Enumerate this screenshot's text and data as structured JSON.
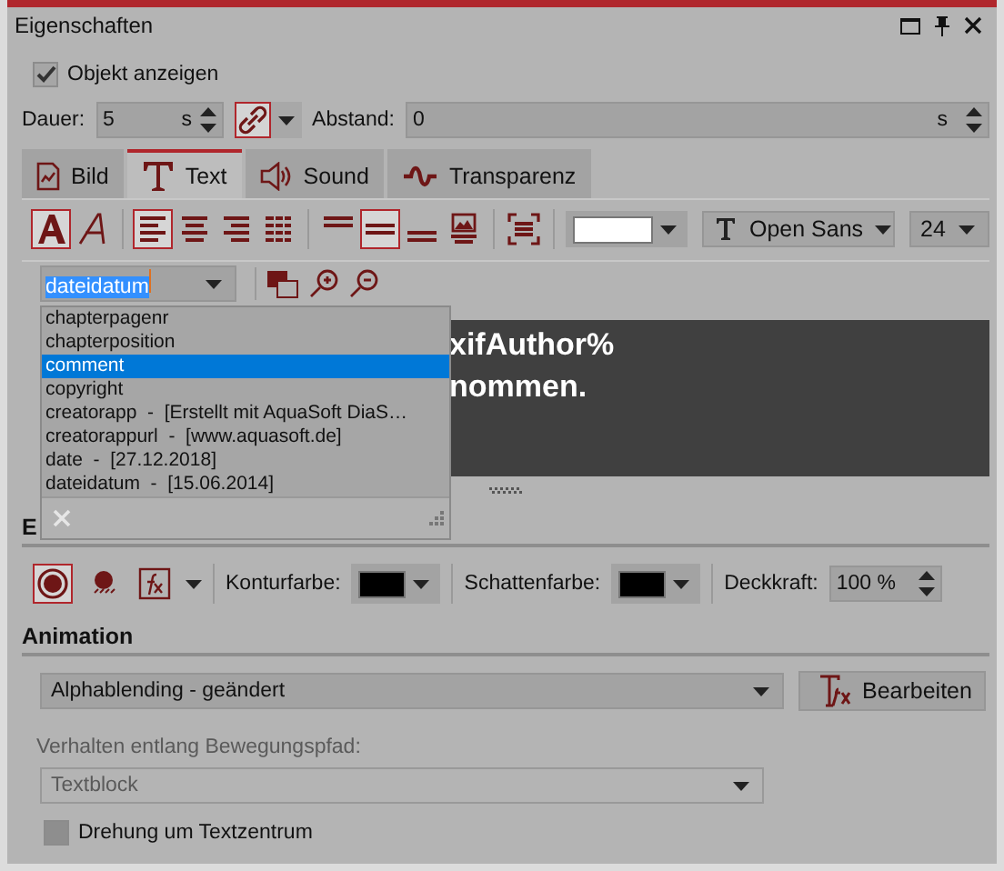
{
  "window": {
    "title": "Eigenschaften"
  },
  "show_object": {
    "label": "Objekt anzeigen",
    "checked": true
  },
  "duration": {
    "label": "Dauer:",
    "value": "5",
    "unit": "s"
  },
  "spacing": {
    "label": "Abstand:",
    "value": "0",
    "unit": "s"
  },
  "tabs": [
    {
      "label": "Bild",
      "kind": "image",
      "selected": false
    },
    {
      "label": "Text",
      "kind": "text",
      "selected": true
    },
    {
      "label": "Sound",
      "kind": "sound",
      "selected": false
    },
    {
      "label": "Transparenz",
      "kind": "wave",
      "selected": false
    }
  ],
  "text_tool_groups": [
    [
      {
        "kind": "outline-letter",
        "selected": true
      },
      {
        "kind": "italic-letter",
        "selected": false
      }
    ],
    [
      {
        "kind": "align-left",
        "selected": true
      },
      {
        "kind": "align-center",
        "selected": false
      },
      {
        "kind": "align-right",
        "selected": false
      },
      {
        "kind": "align-justify",
        "selected": false
      }
    ],
    [
      {
        "kind": "valign-top",
        "selected": false
      },
      {
        "kind": "valign-middle",
        "selected": true
      },
      {
        "kind": "valign-bottom",
        "selected": false
      },
      {
        "kind": "image-text",
        "selected": false
      }
    ],
    [
      {
        "kind": "fit",
        "selected": false
      }
    ]
  ],
  "text_color": {
    "color": "#ffffff"
  },
  "font": {
    "value": "Open Sans"
  },
  "size": {
    "value": "24"
  },
  "placeholder_field": {
    "value": "dateidatum"
  },
  "suggestions": [
    {
      "label": "chapterpagenr",
      "selected": false
    },
    {
      "label": "chapterposition",
      "selected": false
    },
    {
      "label": "comment",
      "selected": true
    },
    {
      "label": "copyright",
      "selected": false
    },
    {
      "label": "creatorapp  -  [Erstellt mit AquaSoft DiaS…",
      "selected": false
    },
    {
      "label": "creatorappurl  -  [www.aquasoft.de]",
      "selected": false
    },
    {
      "label": "date  -  [27.12.2018]",
      "selected": false
    },
    {
      "label": "dateidatum  -  [15.06.2014]",
      "selected": false
    }
  ],
  "preview": {
    "lines": [
      "xifAuthor%",
      "nommen."
    ]
  },
  "effects": {
    "title": "E",
    "tools": [
      {
        "kind": "outline",
        "selected": true
      },
      {
        "kind": "shadow",
        "selected": false
      },
      {
        "kind": "fx",
        "selected": false
      }
    ],
    "outline_color": {
      "label": "Konturfarbe:",
      "color": "#000000"
    },
    "shadow_color": {
      "label": "Schattenfarbe:",
      "color": "#000000"
    },
    "opacity": {
      "label": "Deckkraft:",
      "value": "100 %"
    }
  },
  "animation": {
    "title": "Animation",
    "value": "Alphablending - geändert",
    "button": "Bearbeiten"
  },
  "path_behaviour": {
    "label": "Verhalten entlang Bewegungspfad:",
    "value": "Textblock",
    "disabled": true
  },
  "rotate_center": {
    "label": "Drehung um Textzentrum",
    "checked": false
  }
}
